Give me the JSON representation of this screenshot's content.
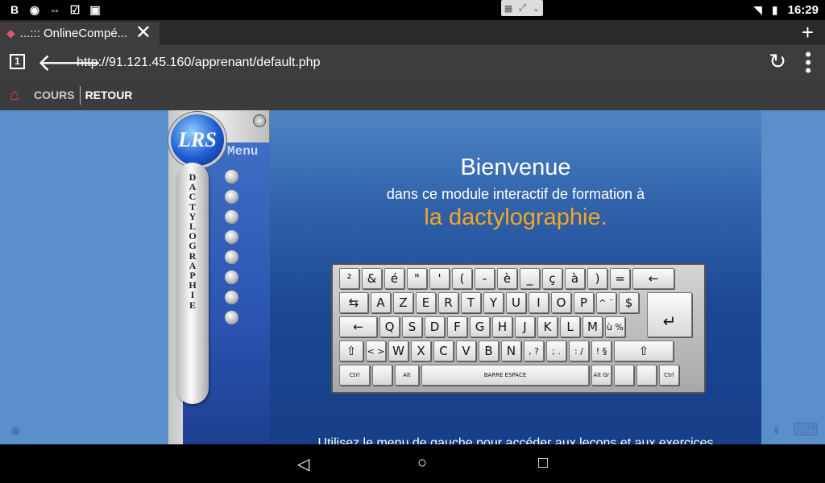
{
  "status_bar": {
    "left_icons": [
      "b-icon",
      "eye-icon",
      "teamviewer-icon",
      "checklist-icon",
      "briefcase-icon"
    ],
    "center_icons": [
      "grid-icon",
      "expand-icon",
      "chevron-down-icon"
    ],
    "time": "16:29"
  },
  "browser": {
    "tab_title": "...::: OnlineCompé...",
    "tab_count": "1",
    "url": "http://91.121.45.160/apprenant/default.php"
  },
  "site_nav": {
    "items": [
      {
        "label": "COURS"
      },
      {
        "label": "RETOUR"
      }
    ]
  },
  "sidebar": {
    "logo_text": "LRS",
    "vertical_title": [
      "D",
      "A",
      "C",
      "T",
      "Y",
      "L",
      "O",
      "G",
      "R",
      "A",
      "P",
      "H",
      "I",
      "E"
    ],
    "menu_label": "Menu",
    "menu_bullet_count": 8
  },
  "main": {
    "welcome": "Bienvenue",
    "subtitle": "dans ce module interactif de formation  à",
    "highlight": "la dactylographie.",
    "hint": "Utilisez le menu de gauche pour accéder aux leçons et aux exercices"
  },
  "keyboard": {
    "rows": [
      [
        "²",
        "&",
        "é",
        "\"",
        "'",
        "(",
        "-",
        "è",
        "_",
        "ç",
        "à",
        ")",
        "=",
        "←"
      ],
      [
        "⇆",
        "A",
        "Z",
        "E",
        "R",
        "T",
        "Y",
        "U",
        "I",
        "O",
        "P",
        "^ ¨",
        "$"
      ],
      [
        "←",
        "Q",
        "S",
        "D",
        "F",
        "G",
        "H",
        "J",
        "K",
        "L",
        "M",
        "ù %"
      ],
      [
        "⇧",
        "< >",
        "W",
        "X",
        "C",
        "V",
        "B",
        "N",
        ", ?",
        "; .",
        ": /",
        "! §",
        "⇧"
      ],
      [
        "Ctrl",
        "",
        "Alt",
        "BARRE ESPACE",
        "Alt Gr",
        "",
        "",
        "Ctrl"
      ]
    ],
    "enter": "↵"
  },
  "colors": {
    "page_bg": "#5b8fcb",
    "highlight": "#f5a623",
    "home_icon": "#e8443b"
  }
}
